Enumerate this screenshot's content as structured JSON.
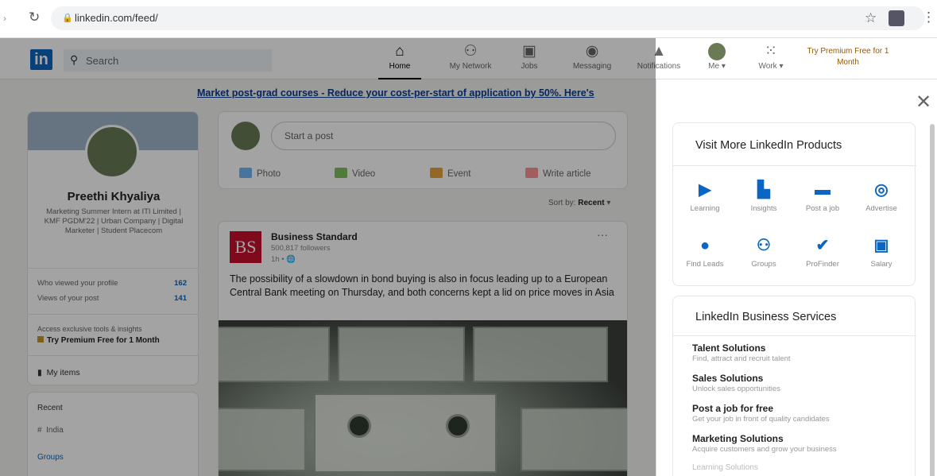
{
  "browser": {
    "url": "linkedin.com/feed/"
  },
  "nav": {
    "search_placeholder": "Search",
    "items": [
      {
        "label": "Home",
        "icon": "home-icon"
      },
      {
        "label": "My Network",
        "icon": "network-icon"
      },
      {
        "label": "Jobs",
        "icon": "briefcase-icon"
      },
      {
        "label": "Messaging",
        "icon": "message-icon"
      },
      {
        "label": "Notifications",
        "icon": "bell-icon"
      },
      {
        "label": "Me",
        "icon": "avatar"
      },
      {
        "label": "Work",
        "icon": "grid-icon"
      }
    ],
    "premium": "Try Premium Free for 1 Month"
  },
  "promo": "Market post-grad courses - Reduce your cost-per-start of application by 50%. Here's",
  "profile": {
    "name": "Preethi Khyaliya",
    "headline": "Marketing Summer Intern at ITI Limited | KMF PGDM'22 | Urban Company | Digital Marketer | Student Placecom",
    "stats": [
      {
        "label": "Who viewed your profile",
        "value": "162"
      },
      {
        "label": "Views of your post",
        "value": "141"
      }
    ],
    "premium_note": "Access exclusive tools & insights",
    "premium_link": "Try Premium Free for 1 Month",
    "my_items": "My items"
  },
  "recent": {
    "label": "Recent",
    "item": "India",
    "groups": "Groups"
  },
  "composer": {
    "placeholder": "Start a post",
    "actions": [
      "Photo",
      "Video",
      "Event",
      "Write article"
    ]
  },
  "sort": {
    "label": "Sort by:",
    "value": "Recent"
  },
  "post": {
    "author": "Business Standard",
    "followers": "500,817 followers",
    "time": "1h •",
    "logo_text": "BS",
    "text": "The possibility of a slowdown in bond buying is also in focus leading up to a European Central Bank meeting on Thursday, and both concerns kept a lid on price moves in Asia"
  },
  "panel": {
    "products_title": "Visit More LinkedIn Products",
    "products": [
      {
        "label": "Learning",
        "icon": "play-icon"
      },
      {
        "label": "Insights",
        "icon": "insights-icon"
      },
      {
        "label": "Post a job",
        "icon": "briefcase-icon"
      },
      {
        "label": "Advertise",
        "icon": "target-icon"
      },
      {
        "label": "Find Leads",
        "icon": "compass-icon"
      },
      {
        "label": "Groups",
        "icon": "groups-icon"
      },
      {
        "label": "ProFinder",
        "icon": "profinder-icon"
      },
      {
        "label": "Salary",
        "icon": "salary-icon"
      }
    ],
    "services_title": "LinkedIn Business Services",
    "services": [
      {
        "title": "Talent Solutions",
        "desc": "Find, attract and recruit talent"
      },
      {
        "title": "Sales Solutions",
        "desc": "Unlock sales opportunities"
      },
      {
        "title": "Post a job for free",
        "desc": "Get your job in front of quality candidates"
      },
      {
        "title": "Marketing Solutions",
        "desc": "Acquire customers and grow your business"
      },
      {
        "title": "Learning Solutions",
        "desc": ""
      }
    ]
  }
}
